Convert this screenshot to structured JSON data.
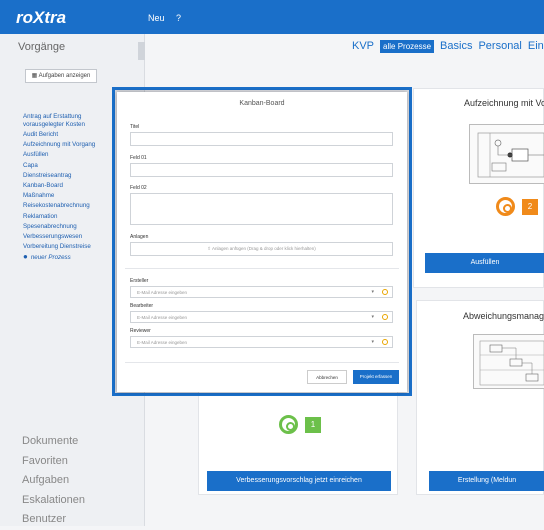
{
  "topbar": {
    "brand": "roXtra",
    "nav": [
      "Neu",
      "?"
    ]
  },
  "sidebar": {
    "title": "Vorgänge",
    "button_label": "Aufgaben anzeigen",
    "items": [
      "Antrag auf Erstattung vorausgelegter Kosten",
      "Audit Bericht",
      "Aufzeichnung mit Vorgang",
      "Ausfüllen",
      "Capa",
      "Dienstreiseantrag",
      "Kanban-Board",
      "Maßnahme",
      "Reisekostenabrechnung",
      "Reklamation",
      "Spesenabrechnung",
      "Verbesserungswesen",
      "Vorbereitung Dienstreise"
    ],
    "new_process": "neuer Prozess",
    "bottom": [
      "Dokumente",
      "Favoriten",
      "Aufgaben",
      "Eskalationen",
      "Benutzer"
    ]
  },
  "tabs": [
    "KVP",
    "alle Prozesse",
    "Basics",
    "Personal",
    "Ein"
  ],
  "cards": {
    "aufzeichnung": {
      "title": "Aufzeichnung mit Vo",
      "badge": "2",
      "button": "Ausfüllen"
    },
    "verbesserung": {
      "badge": "1",
      "button": "Verbesserungsvorschlag jetzt einreichen"
    },
    "abweichung": {
      "title": "Abweichungsmanag",
      "button": "Erstellung (Meldun"
    }
  },
  "modal": {
    "title": "Kanban-Board",
    "fields": {
      "titel": "Titel",
      "feld01": "Feld 01",
      "feld02": "Feld 02",
      "anlagen": "Anlagen"
    },
    "upload_text": "Anlagen anfügen (Drag & drop oder klick hierhalten)",
    "ersteller_label": "Ersteller",
    "ersteller_placeholder": "E-Mail Adresse eingeben",
    "bearbeiter_label": "Bearbeiter",
    "bearbeiter_placeholder": "E-Mail Adresse eingeben",
    "reviewer_label": "Reviewer",
    "reviewer_placeholder": "E-Mail Adresse eingeben",
    "cancel": "Abbrechen",
    "submit": "Projekt erfassen"
  },
  "colors": {
    "accent": "#1a6fc9",
    "orange": "#f08a1a",
    "green": "#6cc04a"
  }
}
